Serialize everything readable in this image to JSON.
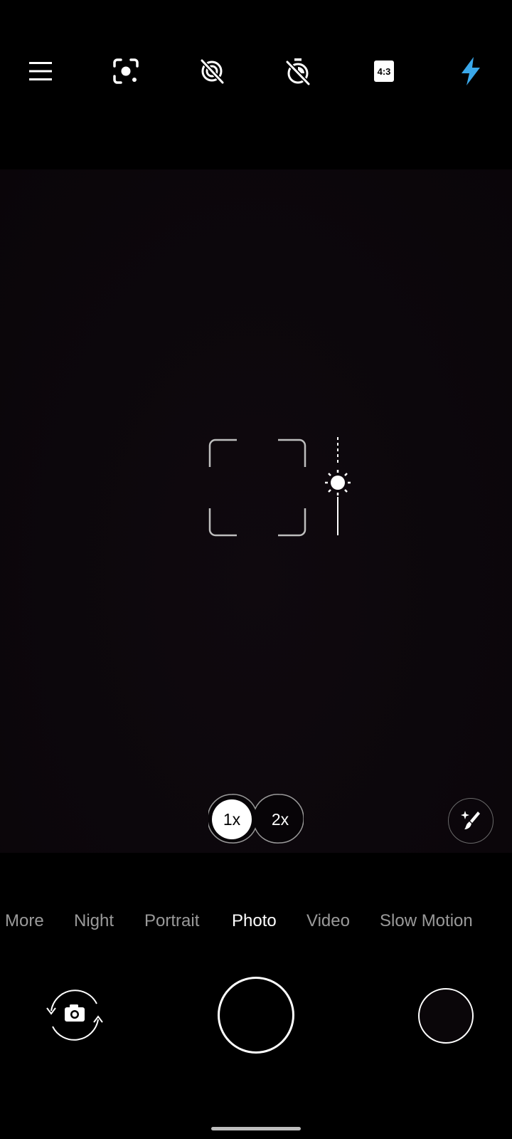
{
  "toolbar": {
    "buttons": [
      {
        "name": "menu",
        "icon": "menu-icon"
      },
      {
        "name": "lens",
        "icon": "google-lens-icon"
      },
      {
        "name": "ai-scene-off",
        "icon": "ai-scene-off-icon"
      },
      {
        "name": "timer-off",
        "icon": "timer-off-icon"
      },
      {
        "name": "aspect-ratio",
        "icon": "aspect-ratio-icon",
        "label": "4:3"
      },
      {
        "name": "flash",
        "icon": "flash-icon",
        "color": "#3aa8ea"
      }
    ]
  },
  "viewfinder": {
    "focus_frame_icon": "focus-frame-icon",
    "exposure_icon": "sun-exposure-icon"
  },
  "zoom": {
    "options": [
      "1x",
      "2x"
    ],
    "selected": "1x"
  },
  "beauty": {
    "icon": "magic-brush-icon"
  },
  "modes": {
    "items": [
      "More",
      "Night",
      "Portrait",
      "Photo",
      "Video",
      "Slow Motion"
    ],
    "active": "Photo"
  },
  "controls": {
    "switch_camera_icon": "switch-camera-icon",
    "shutter_icon": "shutter-button",
    "gallery_icon": "gallery-thumbnail"
  },
  "colors": {
    "flash_accent": "#3aa8ea",
    "background": "#000000",
    "mode_inactive": "#9a9a9a",
    "mode_active": "#ffffff"
  }
}
